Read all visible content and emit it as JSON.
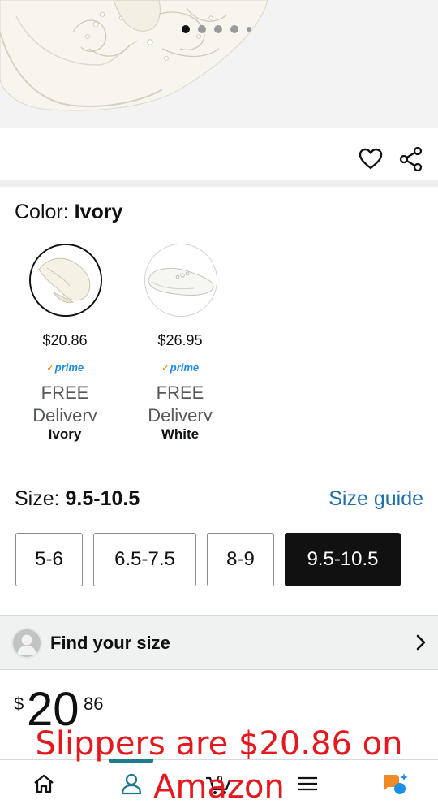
{
  "image_pager": {
    "dot_count": 5,
    "active_index": 0
  },
  "actions": {
    "wishlist_icon": "heart-icon",
    "share_icon": "share-icon"
  },
  "color": {
    "label": "Color: ",
    "selected": "Ivory",
    "options": [
      {
        "price": "$20.86",
        "prime": "prime",
        "delivery": "FREE Delivery",
        "name": "Ivory"
      },
      {
        "price": "$26.95",
        "prime": "prime",
        "delivery": "FREE Delivery",
        "name": "White"
      }
    ]
  },
  "size": {
    "label": "Size: ",
    "selected": "9.5-10.5",
    "guide_link": "Size guide",
    "options": [
      "5-6",
      "6.5-7.5",
      "8-9",
      "9.5-10.5"
    ]
  },
  "find_size": {
    "label": "Find your size",
    "icon": "chevron-right-icon"
  },
  "price": {
    "currency": "$",
    "whole": "20",
    "fraction": "86"
  },
  "nav": {
    "items": [
      "home-icon",
      "account-icon",
      "cart-icon",
      "menu-icon",
      "rufus-icon"
    ],
    "active": "account-icon",
    "cart_count": "0"
  },
  "caption": {
    "line1": "Slippers are $20.86 on",
    "line2": "Amazon"
  },
  "colors": {
    "accent_link": "#1f6fa8",
    "prime_blue": "#1f8ad8",
    "prime_check": "#f08804",
    "caption_red": "#e3191f",
    "nav_active": "#1f7a8c"
  }
}
